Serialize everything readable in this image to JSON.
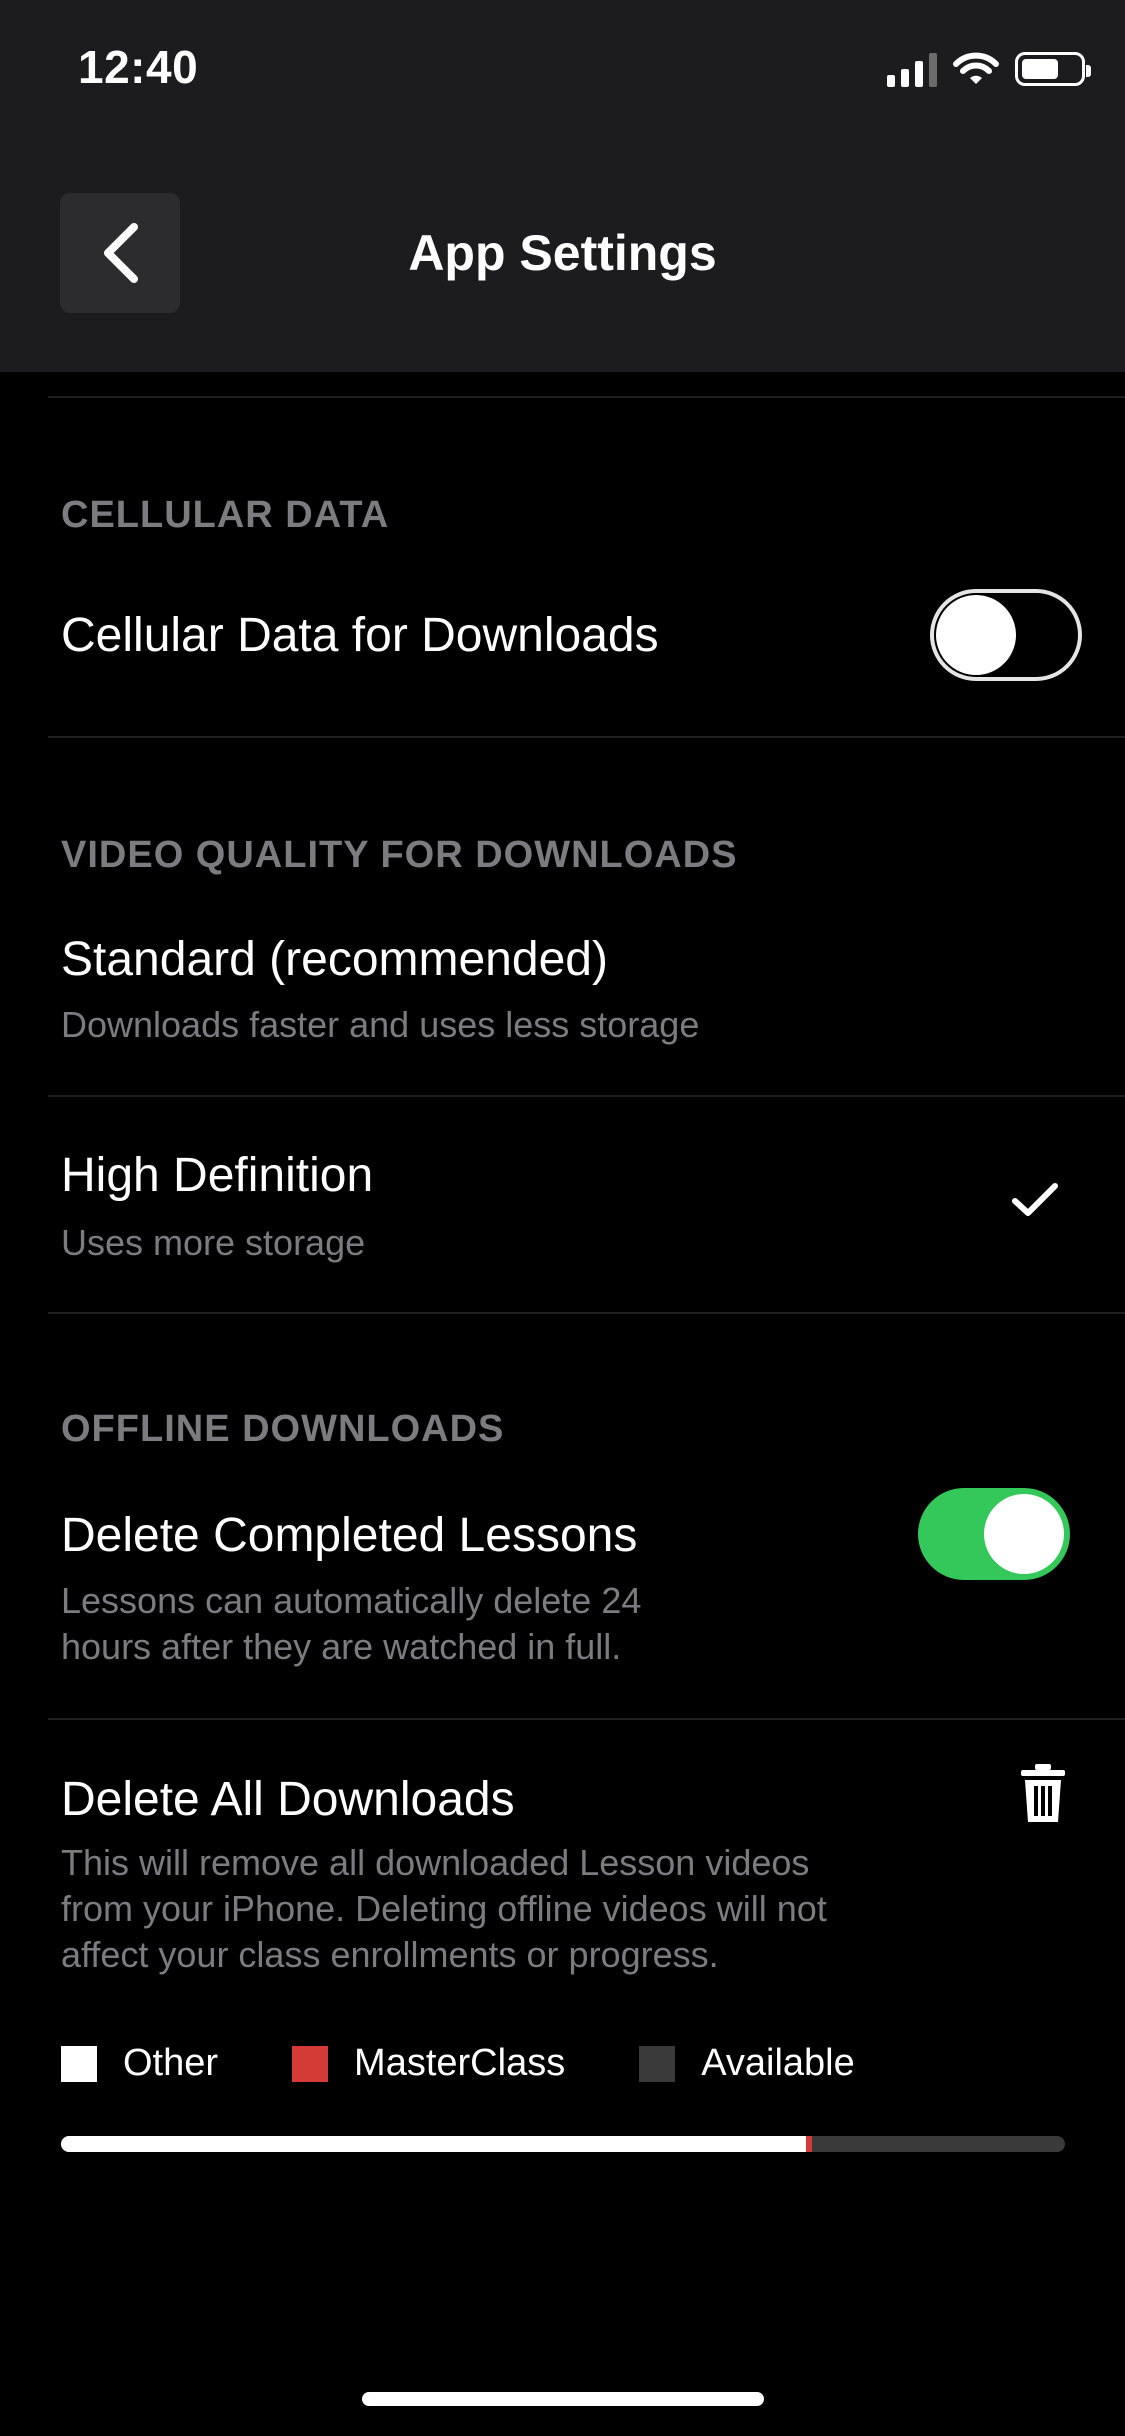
{
  "status_bar": {
    "time": "12:40"
  },
  "nav": {
    "title": "App Settings",
    "back_icon": "chevron-left-icon"
  },
  "sections": {
    "cellular": {
      "header": "CELLULAR DATA",
      "row_title": "Cellular Data for Downloads",
      "toggle_on": false
    },
    "video_quality": {
      "header": "VIDEO QUALITY FOR DOWNLOADS",
      "options": [
        {
          "title": "Standard (recommended)",
          "subtitle": "Downloads faster and uses less storage",
          "selected": false
        },
        {
          "title": "High Definition",
          "subtitle": "Uses more storage",
          "selected": true
        }
      ]
    },
    "offline": {
      "header": "OFFLINE DOWNLOADS",
      "delete_completed": {
        "title": "Delete Completed Lessons",
        "subtitle_line1": "Lessons can automatically delete 24",
        "subtitle_line2": "hours after they are watched in full.",
        "toggle_on": true
      },
      "delete_all": {
        "title": "Delete All Downloads",
        "subtitle_line1": "This will remove all downloaded Lesson videos",
        "subtitle_line2": "from your iPhone. Deleting offline videos will not",
        "subtitle_line3": "affect your class enrollments or progress.",
        "icon": "trash-icon"
      }
    }
  },
  "storage": {
    "legend": [
      {
        "label": "Other",
        "color": "#ffffff"
      },
      {
        "label": "MasterClass",
        "color": "#d43a36"
      },
      {
        "label": "Available",
        "color": "#3a3a3a"
      }
    ],
    "fractions": {
      "other": 0.742,
      "masterclass": 0.006,
      "available": 0.252
    }
  },
  "colors": {
    "toggle_on": "#34c759",
    "accent_red": "#d43a36"
  }
}
